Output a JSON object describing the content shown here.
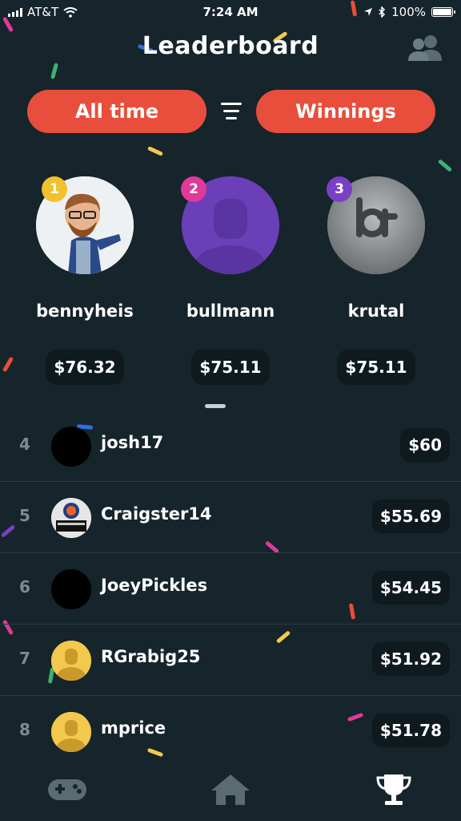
{
  "status_bar": {
    "carrier": "AT&T",
    "time": "7:24 AM",
    "battery": "100%"
  },
  "header": {
    "title": "Leaderboard"
  },
  "filters": {
    "period_label": "All time",
    "metric_label": "Winnings"
  },
  "podium": [
    {
      "rank": "1",
      "username": "bennyheis",
      "amount": "$76.32",
      "badge_color": "#f2c12e"
    },
    {
      "rank": "2",
      "username": "bullmann",
      "amount": "$75.11",
      "badge_color": "#e0399a"
    },
    {
      "rank": "3",
      "username": "krutal",
      "amount": "$75.11",
      "badge_color": "#7a3fc4"
    }
  ],
  "rows": [
    {
      "rank": "4",
      "username": "josh17",
      "amount": "$60"
    },
    {
      "rank": "5",
      "username": "Craigster14",
      "amount": "$55.69"
    },
    {
      "rank": "6",
      "username": "JoeyPickles",
      "amount": "$54.45"
    },
    {
      "rank": "7",
      "username": "RGrabig25",
      "amount": "$51.92"
    },
    {
      "rank": "8",
      "username": "mprice",
      "amount": "$51.78"
    }
  ],
  "tabbar": {
    "items": [
      "gamepad-icon",
      "home-icon",
      "trophy-icon"
    ],
    "active": "trophy-icon"
  },
  "colors": {
    "background": "#16242b",
    "accent": "#e84e3b",
    "avatar_purple": "#6a3fb8",
    "avatar_yellow": "#f2c94c"
  }
}
